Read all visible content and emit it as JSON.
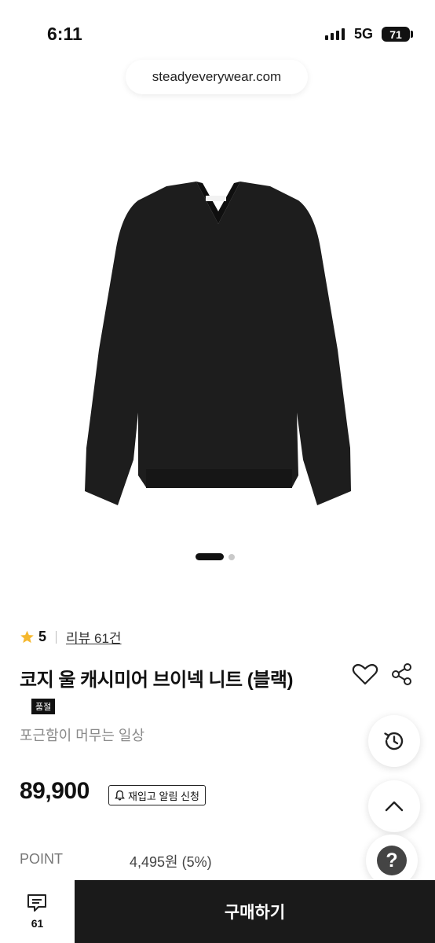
{
  "status_bar": {
    "time": "6:11",
    "network": "5G",
    "battery": "71"
  },
  "browser": {
    "url": "steadyeverywear.com"
  },
  "gallery": {
    "active_index": 1,
    "total": 2
  },
  "product": {
    "rating": "5",
    "reviews": "리뷰 61건",
    "title": "코지 울 캐시미어 브이넥 니트 (블랙)",
    "badge": "품절",
    "subtitle": "포근함이 머무는 일상",
    "price": "89,900",
    "restock_label": "재입고 알림 신청",
    "point_label": "POINT",
    "point_value": "4,495원 (5%)"
  },
  "bottom_bar": {
    "chat_count": "61",
    "buy_label": "구매하기"
  },
  "icons": [
    "star-icon",
    "heart-icon",
    "share-icon",
    "bell-icon",
    "history-icon",
    "chevron-up-icon",
    "help-icon",
    "chat-icon"
  ],
  "colors": {
    "star": "#f5b82e",
    "buy_button": "#1a1a1a"
  }
}
